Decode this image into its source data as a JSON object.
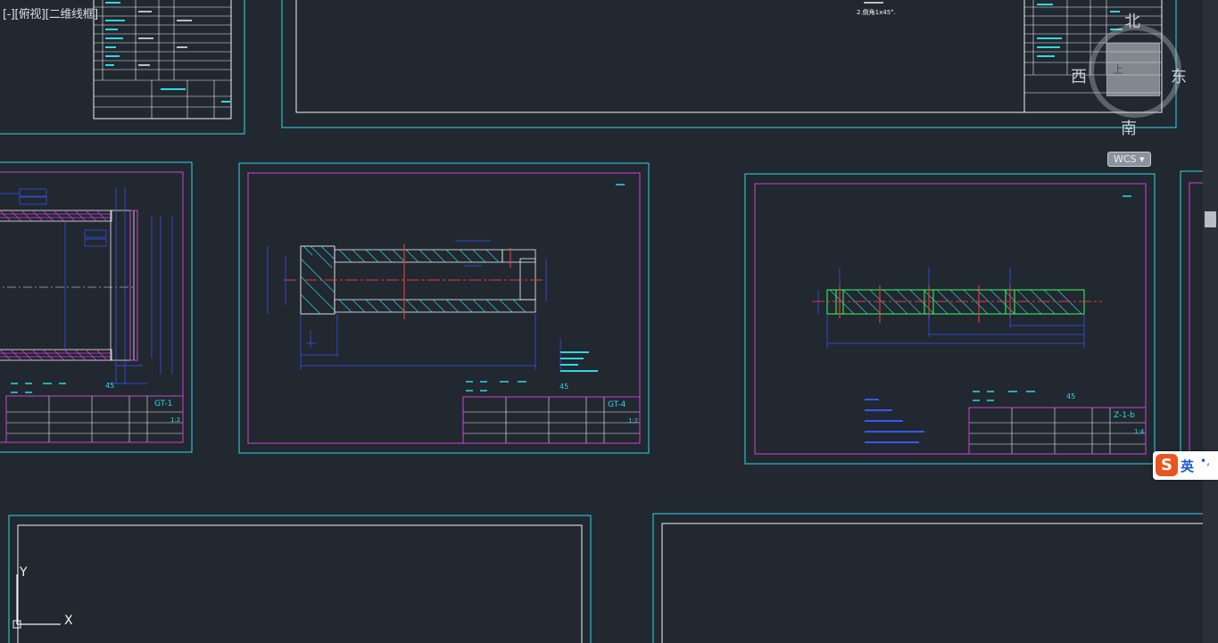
{
  "viewport": {
    "label": "[-][俯视][二维线框]"
  },
  "viewcube": {
    "north": "北",
    "east": "东",
    "south": "南",
    "west": "西",
    "face": "上"
  },
  "wcs": {
    "label": "WCS"
  },
  "ucs": {
    "x": "X",
    "y": "Y"
  },
  "ime": {
    "logo": "S",
    "language": "英",
    "indicator": "•,"
  },
  "sheets": {
    "top_right": {
      "note": "2.倒角1x45°."
    },
    "gt1": {
      "material": "45",
      "code": "GT-1",
      "scale": "1:2"
    },
    "gt4": {
      "material": "45",
      "code": "GT-4",
      "scale": "1:2"
    },
    "z16": {
      "material": "45",
      "code": "Z-1-b",
      "scale": "1:4"
    }
  },
  "colors": {
    "background": "#212830",
    "frame_cyan": "#2fd8e8",
    "frame_magenta": "#d13fd6",
    "line_white": "#f2f2f2",
    "line_blue": "#3b55ff",
    "line_red": "#e23b3b",
    "line_green": "#3cff5a",
    "hatch_cyan": "#2fd8e8"
  }
}
